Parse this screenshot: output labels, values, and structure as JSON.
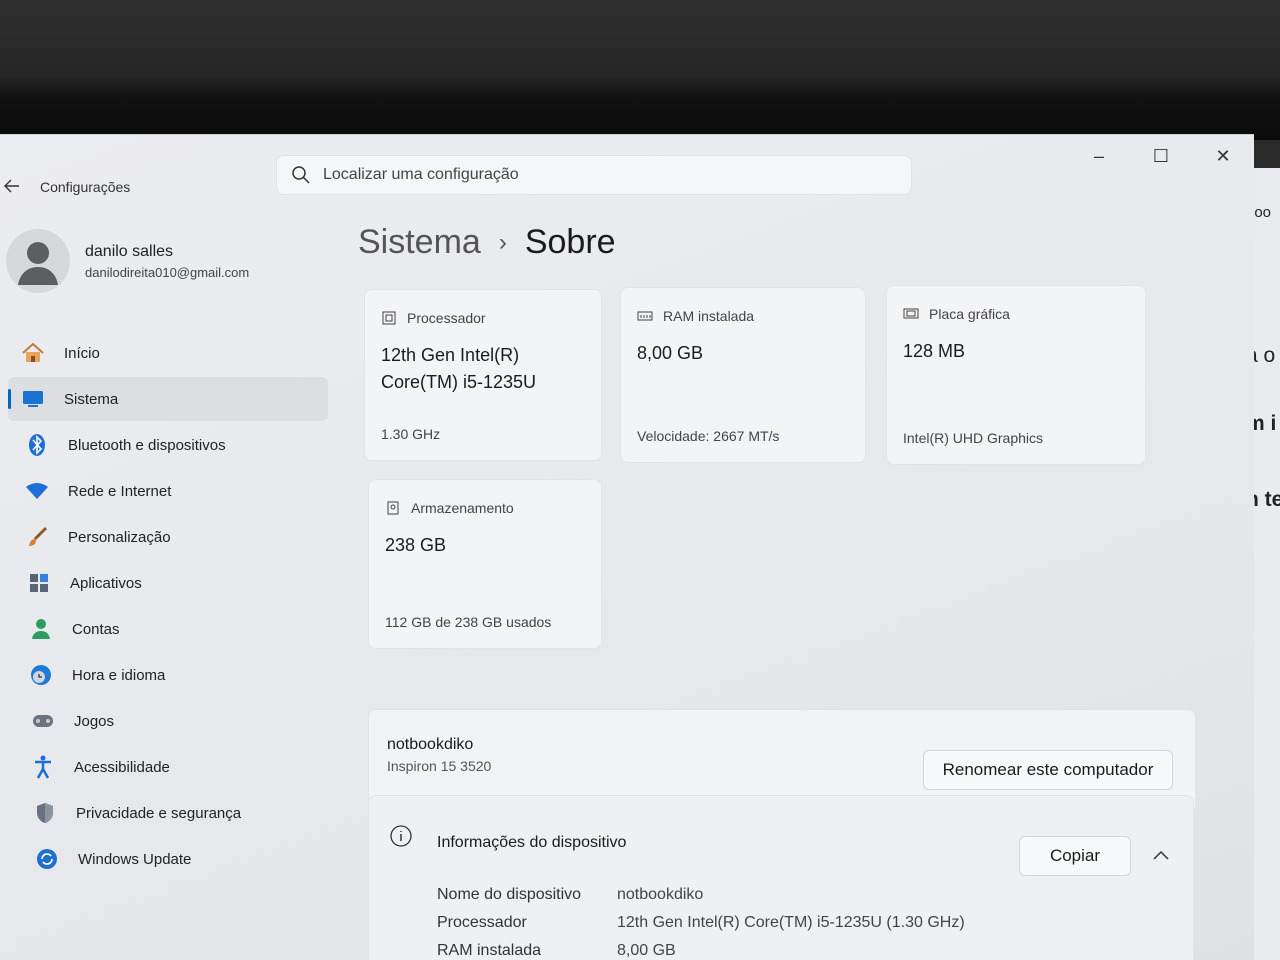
{
  "app": {
    "title": "Configurações",
    "back_icon": "arrow-left-icon"
  },
  "search": {
    "placeholder": "Localizar uma configuração",
    "icon": "search-icon"
  },
  "window_controls": {
    "minimize": "–",
    "maximize": "☐",
    "close": "✕"
  },
  "profile": {
    "name": "danilo salles",
    "email": "danilodireita010@gmail.com"
  },
  "sidebar": {
    "items": [
      {
        "label": "Início",
        "icon": "home-icon",
        "active": false
      },
      {
        "label": "Sistema",
        "icon": "system-icon",
        "active": true
      },
      {
        "label": "Bluetooth e dispositivos",
        "icon": "bluetooth-icon",
        "active": false
      },
      {
        "label": "Rede e Internet",
        "icon": "wifi-icon",
        "active": false
      },
      {
        "label": "Personalização",
        "icon": "brush-icon",
        "active": false
      },
      {
        "label": "Aplicativos",
        "icon": "apps-icon",
        "active": false
      },
      {
        "label": "Contas",
        "icon": "account-icon",
        "active": false
      },
      {
        "label": "Hora e idioma",
        "icon": "clock-globe-icon",
        "active": false
      },
      {
        "label": "Jogos",
        "icon": "gamepad-icon",
        "active": false
      },
      {
        "label": "Acessibilidade",
        "icon": "accessibility-icon",
        "active": false
      },
      {
        "label": "Privacidade e segurança",
        "icon": "shield-icon",
        "active": false
      },
      {
        "label": "Windows Update",
        "icon": "update-icon",
        "active": false
      }
    ]
  },
  "breadcrumb": {
    "parent": "Sistema",
    "separator": "›",
    "current": "Sobre"
  },
  "specs_cards": {
    "processor": {
      "label": "Processador",
      "value_line1": "12th Gen Intel(R)",
      "value_line2": "Core(TM) i5-1235U",
      "sub": "1.30 GHz"
    },
    "ram": {
      "label": "RAM instalada",
      "value": "8,00 GB",
      "sub": "Velocidade: 2667 MT/s"
    },
    "gpu": {
      "label": "Placa gráfica",
      "value": "128 MB",
      "sub": "Intel(R) UHD Graphics"
    },
    "storage": {
      "label": "Armazenamento",
      "value": "238 GB",
      "sub": "112 GB de 238 GB usados"
    }
  },
  "device": {
    "name": "notbookdiko",
    "model": "Inspiron 15 3520",
    "rename_button": "Renomear este computador"
  },
  "device_info": {
    "title": "Informações do dispositivo",
    "copy_button": "Copiar",
    "collapse_icon": "chevron-up-icon",
    "rows": [
      {
        "key": "Nome do dispositivo",
        "value": "notbookdiko"
      },
      {
        "key": "Processador",
        "value": "12th Gen Intel(R) Core(TM) i5-1235U (1.30 GHz)"
      },
      {
        "key": "RAM instalada",
        "value": "8,00 GB"
      }
    ]
  },
  "background_window_fragments": [
    "ooo",
    "a o",
    "m i",
    "n te"
  ],
  "colors": {
    "accent": "#0067c0",
    "window_bg": "#e8e9ec",
    "card_bg": "#f3f4f6"
  }
}
